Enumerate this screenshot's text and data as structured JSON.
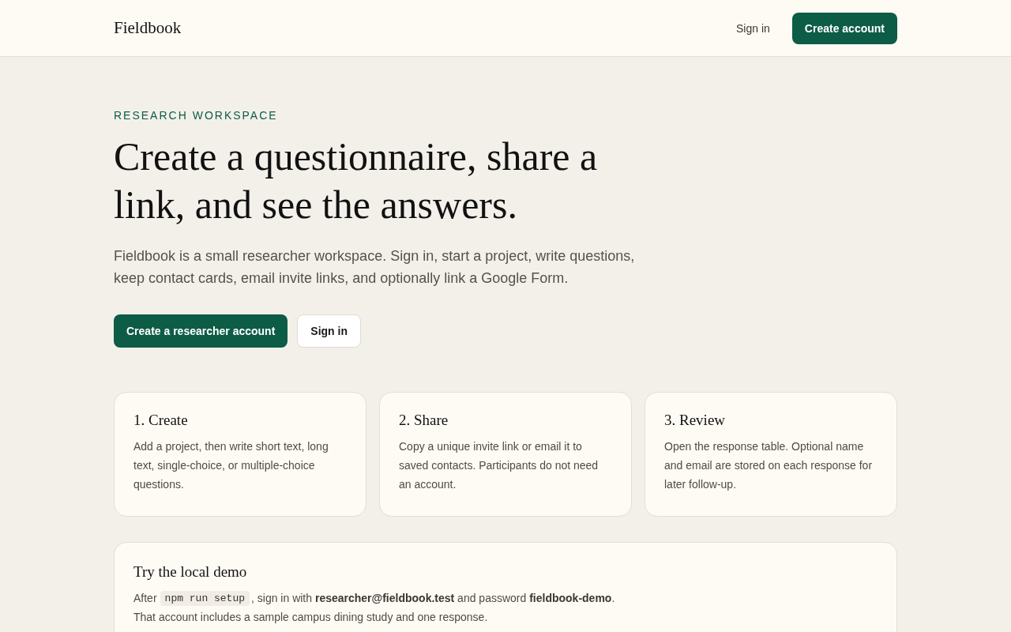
{
  "header": {
    "logo": "Fieldbook",
    "links": [
      {
        "label": "Sign in",
        "kind": "link"
      },
      {
        "label": "Create account",
        "kind": "primary"
      }
    ]
  },
  "hero": {
    "eyebrow": "RESEARCH WORKSPACE",
    "title": "Create a questionnaire, share a link, and see the answers.",
    "description": "Fieldbook is a small researcher workspace. Sign in, start a project, write questions, keep contact cards, email invite links, and optionally link a Google Form.",
    "buttons": [
      {
        "label": "Create a researcher account",
        "kind": "primary"
      },
      {
        "label": "Sign in",
        "kind": "secondary"
      }
    ]
  },
  "steps": [
    {
      "title": "1. Create",
      "text": "Add a project, then write short text, long text, single-choice, or multiple-choice questions."
    },
    {
      "title": "2. Share",
      "text": "Copy a unique invite link or email it to saved contacts. Participants do not need an account."
    },
    {
      "title": "3. Review",
      "text": "Open the response table. Optional name and email are stored on each response for later follow-up."
    }
  ],
  "demo": {
    "title": "Try the local demo",
    "before_code": "After",
    "code": "npm run setup",
    "after_code": ", sign in with **researcher@fieldbook.test** and password **fieldbook-demo**.",
    "note": "That account includes a sample campus dining study and one response."
  }
}
